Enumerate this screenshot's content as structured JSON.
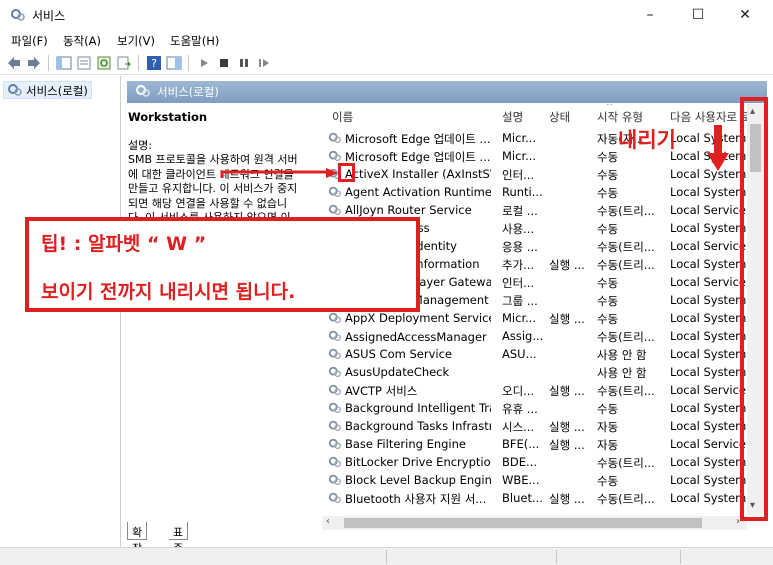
{
  "window": {
    "title": "서비스",
    "min": "–",
    "max": "☐",
    "close": "✕"
  },
  "menu": [
    "파일(F)",
    "동작(A)",
    "보기(V)",
    "도움말(H)"
  ],
  "tree": {
    "node": "서비스(로컬)"
  },
  "pane": {
    "header": "서비스(로컬)"
  },
  "description": {
    "title": "Workstation",
    "label": "설명:",
    "lines": [
      "SMB 프로토콜을 사용하여 원격 서버",
      "에 대한 클라이언트 네트워크 연결을",
      "만들고 유지합니다. 이 서비스가 중지",
      "되면 해당 연결을 사용할 수 없습니",
      "다. 이 서비스를 사용하지 않으면 이"
    ]
  },
  "columns": {
    "name": "이름",
    "desc": "설명",
    "status": "상태",
    "startup": "시작 유형",
    "logon": "다음 사용자로 로그온"
  },
  "rows": [
    {
      "name": "Microsoft Edge 업데이트 ...",
      "desc": "Micr...",
      "status": "",
      "startup": "자동(지...",
      "logon": "Local System"
    },
    {
      "name": "Microsoft Edge 업데이트 ...",
      "desc": "Micr...",
      "status": "",
      "startup": "수동",
      "logon": "Local System"
    },
    {
      "name": "ActiveX Installer (AxInstSV)",
      "desc": "인터...",
      "status": "",
      "startup": "수동",
      "logon": "Local System"
    },
    {
      "name": "Agent Activation Runtime_...",
      "desc": "Runti...",
      "status": "",
      "startup": "수동",
      "logon": "Local System"
    },
    {
      "name": "AllJoyn Router Service",
      "desc": "로컬 ...",
      "status": "",
      "startup": "수동(트리...",
      "logon": "Local Service"
    },
    {
      "name": "App Readiness",
      "desc": "사용...",
      "status": "",
      "startup": "수동",
      "logon": "Local System"
    },
    {
      "name": "Application Identity",
      "desc": "응용 ...",
      "status": "",
      "startup": "수동(트리...",
      "logon": "Local Service"
    },
    {
      "name": "Application Information",
      "desc": "추가...",
      "status": "실행 ...",
      "startup": "수동(트리...",
      "logon": "Local System"
    },
    {
      "name": "Application Layer Gateway ...",
      "desc": "인터...",
      "status": "",
      "startup": "수동",
      "logon": "Local Service"
    },
    {
      "name": "Application Management",
      "desc": "그룹 ...",
      "status": "",
      "startup": "수동",
      "logon": "Local System"
    },
    {
      "name": "AppX Deployment Service ...",
      "desc": "Micr...",
      "status": "실행 ...",
      "startup": "수동",
      "logon": "Local System"
    },
    {
      "name": "AssignedAccessManager 서...",
      "desc": "Assig...",
      "status": "",
      "startup": "수동(트리...",
      "logon": "Local System"
    },
    {
      "name": "ASUS Com Service",
      "desc": "ASU...",
      "status": "",
      "startup": "사용 안 함",
      "logon": "Local System"
    },
    {
      "name": "AsusUpdateCheck",
      "desc": "",
      "status": "",
      "startup": "사용 안 함",
      "logon": "Local System"
    },
    {
      "name": "AVCTP 서비스",
      "desc": "오디...",
      "status": "실행 ...",
      "startup": "수동(트리...",
      "logon": "Local Service"
    },
    {
      "name": "Background Intelligent Tra...",
      "desc": "유휴 ...",
      "status": "",
      "startup": "수동",
      "logon": "Local System"
    },
    {
      "name": "Background Tasks Infrastru...",
      "desc": "시스...",
      "status": "실행 ...",
      "startup": "자동",
      "logon": "Local System"
    },
    {
      "name": "Base Filtering Engine",
      "desc": "BFE(...",
      "status": "실행 ...",
      "startup": "자동",
      "logon": "Local Service"
    },
    {
      "name": "BitLocker Drive Encryption ...",
      "desc": "BDE...",
      "status": "",
      "startup": "수동(트리...",
      "logon": "Local System"
    },
    {
      "name": "Block Level Backup Engine ...",
      "desc": "WBE...",
      "status": "",
      "startup": "수동",
      "logon": "Local System"
    },
    {
      "name": "Bluetooth 사용자 지원 서...",
      "desc": "Bluet...",
      "status": "실행 ...",
      "startup": "수동(트리...",
      "logon": "Local System"
    }
  ],
  "tabs": {
    "extended": "확장",
    "standard": "표준"
  },
  "annotation": {
    "tip_line1": "팁! : 알파벳 “ W ”",
    "tip_line2": "보이기 전까지 내리시면 됩니다.",
    "scroll_label": "내리기"
  },
  "colors": {
    "annotation": "#e02020",
    "header_gradient_top": "#9fb7d3",
    "header_gradient_bottom": "#7f9dc2"
  }
}
